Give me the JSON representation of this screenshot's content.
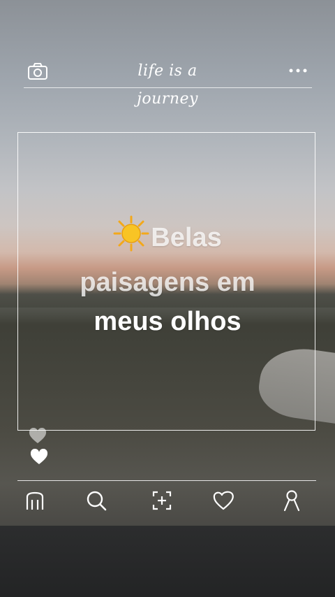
{
  "header": {
    "brand_text": "life is a journey",
    "camera_icon": "camera-icon",
    "more_icon": "more-dots-icon"
  },
  "post": {
    "caption_line1": "Belas",
    "caption_line2": "paisagens em",
    "caption_line3": "meus olhos",
    "emoji": "sun-emoji"
  },
  "side_actions": [
    "heart-icon",
    "heart-icon"
  ],
  "bottom_nav": [
    "home-icon",
    "search-icon",
    "add-post-icon",
    "heart-icon",
    "profile-icon"
  ],
  "colors": {
    "foreground": "#ffffff",
    "sun": "#f5b51b"
  }
}
